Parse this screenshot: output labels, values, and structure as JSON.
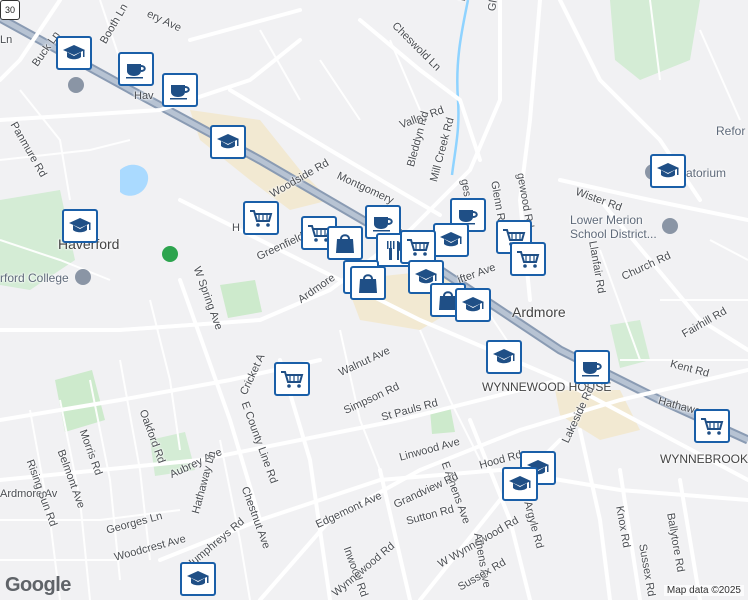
{
  "map": {
    "attribution": "Map data ©2025",
    "logo_text": "Google",
    "route_shield": "30",
    "place_labels": [
      {
        "id": "haverford",
        "text": "Haverford",
        "size": "big"
      },
      {
        "id": "ardmore",
        "text": "Ardmore",
        "size": "big"
      },
      {
        "id": "wynnewood-house",
        "text": "WYNNEWOOD HOUSE",
        "size": "big"
      },
      {
        "id": "wynnebrook-manor",
        "text": "WYNNEBROOK MANOR",
        "size": "big"
      },
      {
        "id": "haverford-college",
        "text": "rford College",
        "size": "poi"
      },
      {
        "id": "lower-merion-school",
        "text": "Lower Merion School District...",
        "size": "poi"
      },
      {
        "id": "reform",
        "text": "Refor",
        "size": "poi"
      },
      {
        "id": "atorium",
        "text": "atorium",
        "size": "poi"
      },
      {
        "id": "ardmore-w",
        "text": "Ardmore Av",
        "size": "small"
      }
    ],
    "street_labels": [
      "Buck Ln",
      "Booth Ln",
      "Panmure Rd",
      "Cheswold Ln",
      "Glenn Rd",
      "Mill Cr",
      "Valley Rd",
      "Woodside Rd",
      "Montgomery",
      "Bleddyn Rd",
      "Mill Creek Rd",
      "Wister Rd",
      "Greenfield A",
      "W Spring Ave",
      "Ardmore",
      "Cricket A",
      "Walnut Ave",
      "Simpson Rd",
      "St Pauls Rd",
      "Linwood Ave",
      "E Athens Ave",
      "Hood Rd",
      "Lakeside Rd",
      "Kent Rd",
      "Hathaway",
      "Church Rd",
      "Fairhill Rd",
      "Llanfair Rd",
      "Glenn Rd",
      "Oakford Rd",
      "Morris Rd",
      "Belmont Ave",
      "Rising Sun Rd",
      "Aubrey Ave",
      "E County Line Rd",
      "Chestnut Ave",
      "Georges Ln",
      "Woodcrest Ave",
      "Humphreys Rd",
      "Hathaway Ln",
      "Edgemont Ave",
      "Grandview Rd",
      "Sutton Rd",
      "W Wynnewood Rd",
      "Athens Ave",
      "Argyle Rd",
      "Sussex Rd",
      "Knox Rd",
      "Sussex Rd",
      "Ballytore Rd",
      "Inwood Rd",
      "Wynnewood Rd",
      "ery Ave",
      "Ln",
      "H",
      "Hav",
      "cke",
      "ges Rd",
      "gewood Rd",
      "ifter Ave"
    ],
    "markers": [
      {
        "type": "school"
      },
      {
        "type": "cafe"
      },
      {
        "type": "cafe"
      },
      {
        "type": "school"
      },
      {
        "type": "shop"
      },
      {
        "type": "school"
      },
      {
        "type": "shop"
      },
      {
        "type": "school"
      },
      {
        "type": "cafe"
      },
      {
        "type": "cafe"
      },
      {
        "type": "school"
      },
      {
        "type": "shop"
      },
      {
        "type": "shop"
      },
      {
        "type": "restaurant"
      },
      {
        "type": "restaurant"
      },
      {
        "type": "shop"
      },
      {
        "type": "shop"
      },
      {
        "type": "school"
      },
      {
        "type": "shop"
      },
      {
        "type": "shop"
      },
      {
        "type": "school"
      },
      {
        "type": "cafe"
      },
      {
        "type": "shop"
      },
      {
        "type": "school"
      },
      {
        "type": "school"
      },
      {
        "type": "shop"
      },
      {
        "type": "school"
      },
      {
        "type": "school"
      }
    ]
  }
}
